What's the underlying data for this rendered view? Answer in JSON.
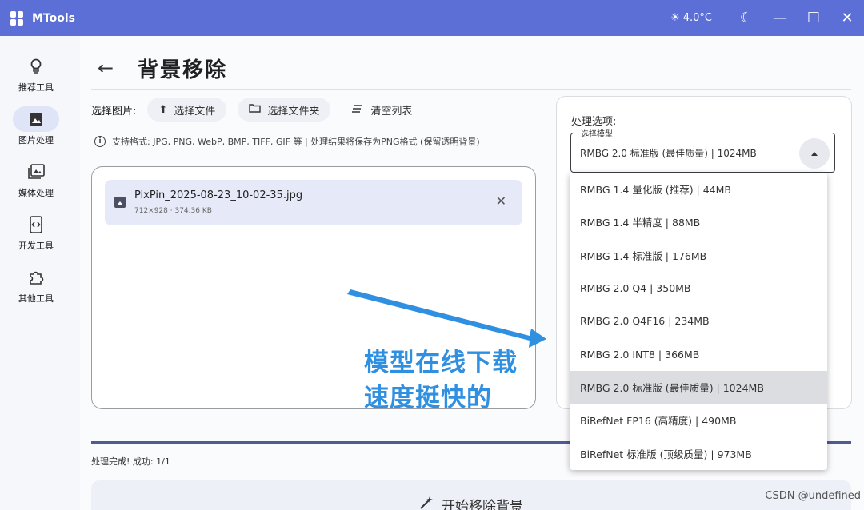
{
  "window": {
    "title": "MTools",
    "weather": "4.0°C"
  },
  "sidebar": {
    "items": [
      {
        "label": "推荐工具",
        "icon": "lightbulb-icon"
      },
      {
        "label": "图片处理",
        "icon": "image-icon",
        "active": true
      },
      {
        "label": "媒体处理",
        "icon": "photo-library-icon"
      },
      {
        "label": "开发工具",
        "icon": "code-icon"
      },
      {
        "label": "其他工具",
        "icon": "puzzle-icon"
      }
    ]
  },
  "page": {
    "title": "背景移除",
    "select_label": "选择图片:",
    "select_file_button": "选择文件",
    "select_folder_button": "选择文件夹",
    "clear_list_button": "清空列表",
    "info_text": "支持格式: JPG, PNG, WebP, BMP, TIFF, GIF 等 | 处理结果将保存为PNG格式 (保留透明背景)",
    "files": [
      {
        "name": "PixPin_2025-08-23_10-02-35.jpg",
        "meta": "712×928 · 374.36 KB"
      }
    ],
    "progress": 1.0,
    "status": "处理完成! 成功: 1/1",
    "start_button": "开始移除背景"
  },
  "options": {
    "label": "处理选项:",
    "model_legend": "选择模型",
    "model_value": "RMBG 2.0 标准版 (最佳质量)  |  1024MB",
    "models": [
      "RMBG 1.4 量化版 (推荐)  |  44MB",
      "RMBG 1.4 半精度  |  88MB",
      "RMBG 1.4 标准版  |  176MB",
      "RMBG 2.0 Q4  |  350MB",
      "RMBG 2.0 Q4F16  |  234MB",
      "RMBG 2.0 INT8  |  366MB",
      "RMBG 2.0 标准版 (最佳质量)  |  1024MB",
      "BiRefNet FP16 (高精度)  |  490MB",
      "BiRefNet 标准版 (顶级质量)  |  973MB"
    ],
    "selected_index": 6
  },
  "annotation": {
    "line1": "模型在线下载",
    "line2": "速度挺快的",
    "color": "#2f8fe0"
  },
  "watermark": "CSDN @undefined",
  "colors": {
    "titlebar": "#5b6fd6",
    "accent": "#4f5b93"
  }
}
